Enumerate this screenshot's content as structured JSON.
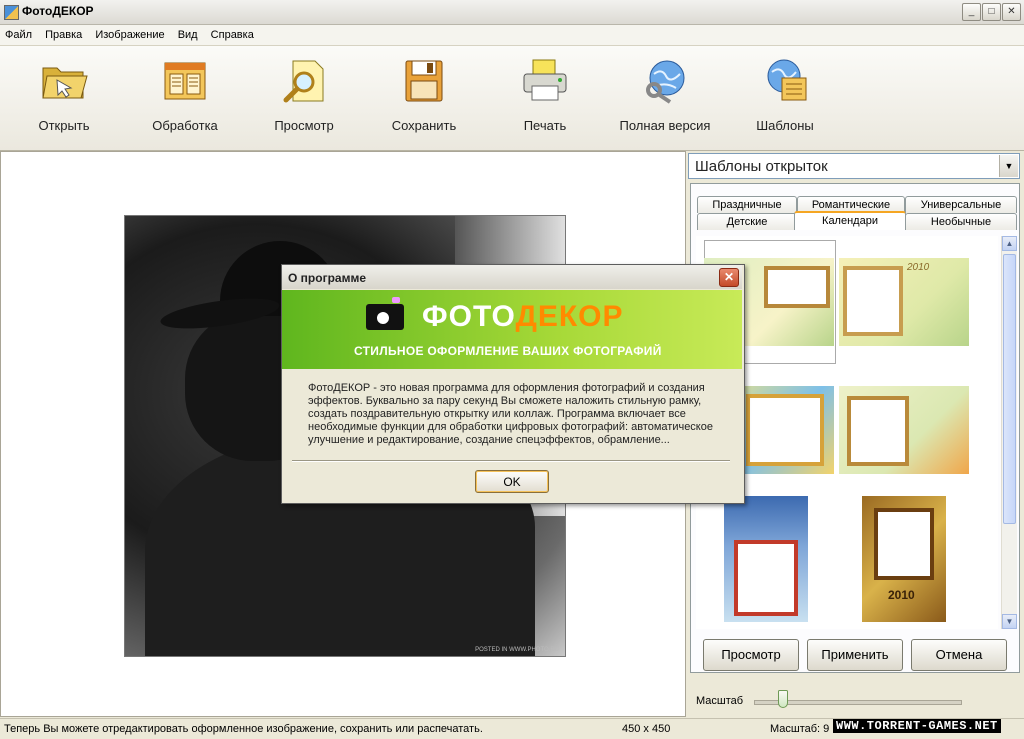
{
  "window": {
    "title": "ФотоДЕКОР",
    "controls": [
      "_",
      "□",
      "✕"
    ]
  },
  "menu": [
    "Файл",
    "Правка",
    "Изображение",
    "Вид",
    "Справка"
  ],
  "toolbar": [
    {
      "label": "Открыть",
      "icon": "open-folder-icon"
    },
    {
      "label": "Обработка",
      "icon": "process-icon"
    },
    {
      "label": "Просмотр",
      "icon": "preview-icon"
    },
    {
      "label": "Сохранить",
      "icon": "save-icon"
    },
    {
      "label": "Печать",
      "icon": "print-icon"
    },
    {
      "label": "Полная версия",
      "icon": "full-version-icon"
    },
    {
      "label": "Шаблоны",
      "icon": "templates-icon"
    }
  ],
  "photo": {
    "credit": "POSTED IN WWW.PHOTO.RU"
  },
  "panel": {
    "select_label": "Шаблоны открыток",
    "tabs_row1": [
      "Праздничные",
      "Романтические",
      "Универсальные"
    ],
    "tabs_row2": [
      "Детские",
      "Календари",
      "Необычные"
    ],
    "active_tab": "Календари",
    "buttons": {
      "preview": "Просмотр",
      "apply": "Применить",
      "cancel": "Отмена"
    },
    "zoom_label": "Масштаб",
    "zoom_fraction": 0.14
  },
  "status": {
    "text": "Теперь Вы можете отредактировать оформленное изображение, сохранить или распечатать.",
    "size": "450 x 450",
    "zoom": "Масштаб: 9"
  },
  "watermark": "WWW.TORRENT-GAMES.NET",
  "dialog": {
    "title": "О программе",
    "close": "✕",
    "brand_part1": "ФОТО",
    "brand_part2": "ДЕКОР",
    "subtitle": "СТИЛЬНОЕ ОФОРМЛЕНИЕ ВАШИХ ФОТОГРАФИЙ",
    "text": "ФотоДЕКОР - это новая программа для оформления фотографий и создания эффектов. Буквально за пару секунд Вы сможете наложить стильную рамку, создать поздравительную открытку или коллаж. Программа включает все необходимые функции для обработки цифровых фотографий: автоматическое улучшение и редактирование, создание спецэффектов, обрамление...",
    "ok": "OK"
  },
  "thumbnails": [
    {
      "name": "calendar-thumb-1",
      "year": ""
    },
    {
      "name": "calendar-thumb-2",
      "year": "2010"
    },
    {
      "name": "calendar-thumb-3",
      "year": ""
    },
    {
      "name": "calendar-thumb-4",
      "year": ""
    },
    {
      "name": "calendar-thumb-5",
      "year": ""
    },
    {
      "name": "calendar-thumb-6",
      "year": "2010"
    }
  ]
}
